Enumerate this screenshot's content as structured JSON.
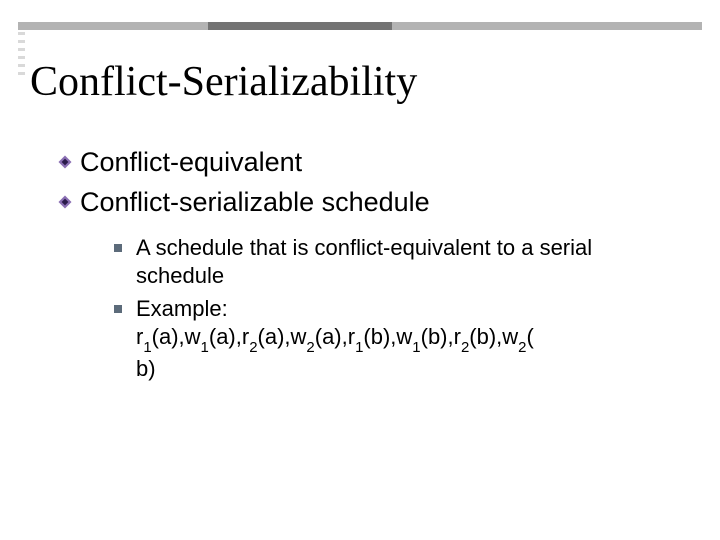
{
  "title": "Conflict-Serializability",
  "bullets": {
    "b1": "Conflict-equivalent",
    "b2": "Conflict-serializable schedule"
  },
  "sub": {
    "s1": "A schedule that is conflict-equivalent to a serial schedule",
    "s2_label": "Example:",
    "s2_ops": [
      {
        "op": "r",
        "sub": "1",
        "arg": "a"
      },
      {
        "op": "w",
        "sub": "1",
        "arg": "a"
      },
      {
        "op": "r",
        "sub": "2",
        "arg": "a"
      },
      {
        "op": "w",
        "sub": "2",
        "arg": "a"
      },
      {
        "op": "r",
        "sub": "1",
        "arg": "b"
      },
      {
        "op": "w",
        "sub": "1",
        "arg": "b"
      },
      {
        "op": "r",
        "sub": "2",
        "arg": "b"
      },
      {
        "op": "w",
        "sub": "2",
        "arg": "b"
      }
    ]
  }
}
